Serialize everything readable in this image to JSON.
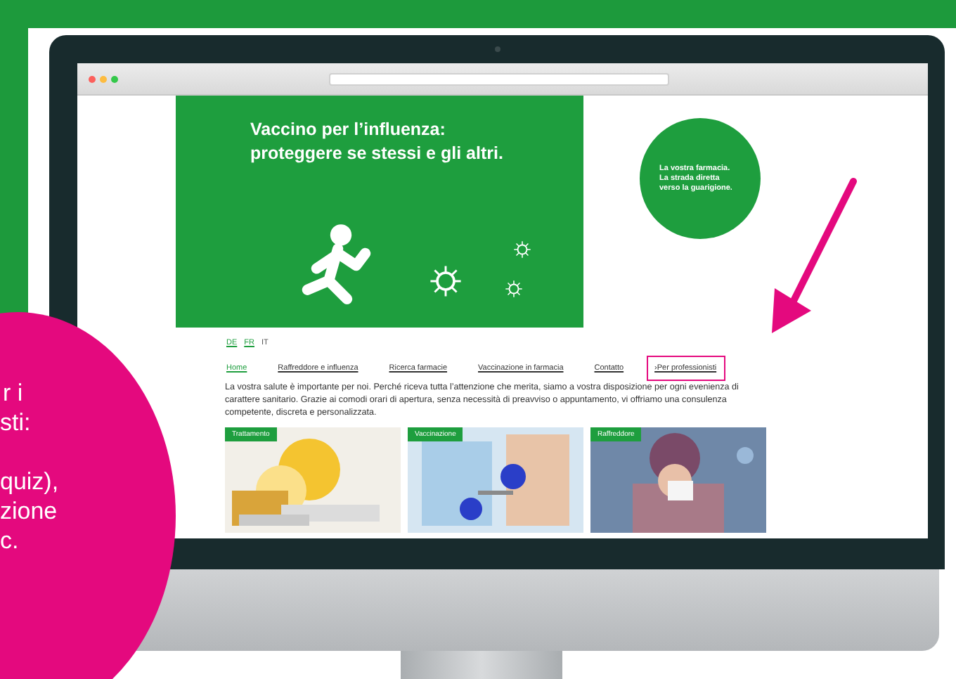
{
  "banner": {
    "headline": [
      "Vaccino per l’influenza:",
      "proteggere se stessi e gli altri."
    ]
  },
  "badge": {
    "lines": [
      "La vostra farmacia.",
      "La strada diretta",
      "verso la guarigione."
    ]
  },
  "languages": [
    {
      "label": "DE",
      "selected": false
    },
    {
      "label": "FR",
      "selected": false
    },
    {
      "label": "IT",
      "selected": true
    }
  ],
  "nav": [
    {
      "label": "Home",
      "selected": true,
      "highlighted": false
    },
    {
      "label": "Raffreddore e influenza",
      "selected": false,
      "highlighted": false
    },
    {
      "label": "Ricerca farmacie",
      "selected": false,
      "highlighted": false
    },
    {
      "label": "Vaccinazione in farmacia",
      "selected": false,
      "highlighted": false
    },
    {
      "label": "Contatto",
      "selected": false,
      "highlighted": false
    },
    {
      "label": "›Per professionisti",
      "selected": false,
      "highlighted": true
    }
  ],
  "intro": "La vostra salute è importante per noi. Perché riceva tutta l’attenzione che merita, siamo a vostra disposizione per ogni evenienza di carattere sanitario. Grazie ai comodi orari di apertura, senza necessità di preavviso o appuntamento, vi offriamo una consulenza competente, discreta e personalizzata.",
  "cards": [
    {
      "tag": "Trattamento",
      "kind": "picture"
    },
    {
      "tag": "Vaccinazione",
      "kind": "picture"
    },
    {
      "tag": "Raffreddore",
      "kind": "picture"
    }
  ],
  "callout": {
    "lines": [
      "r i",
      "sti:",
      "quiz),",
      "zione",
      "c."
    ]
  }
}
